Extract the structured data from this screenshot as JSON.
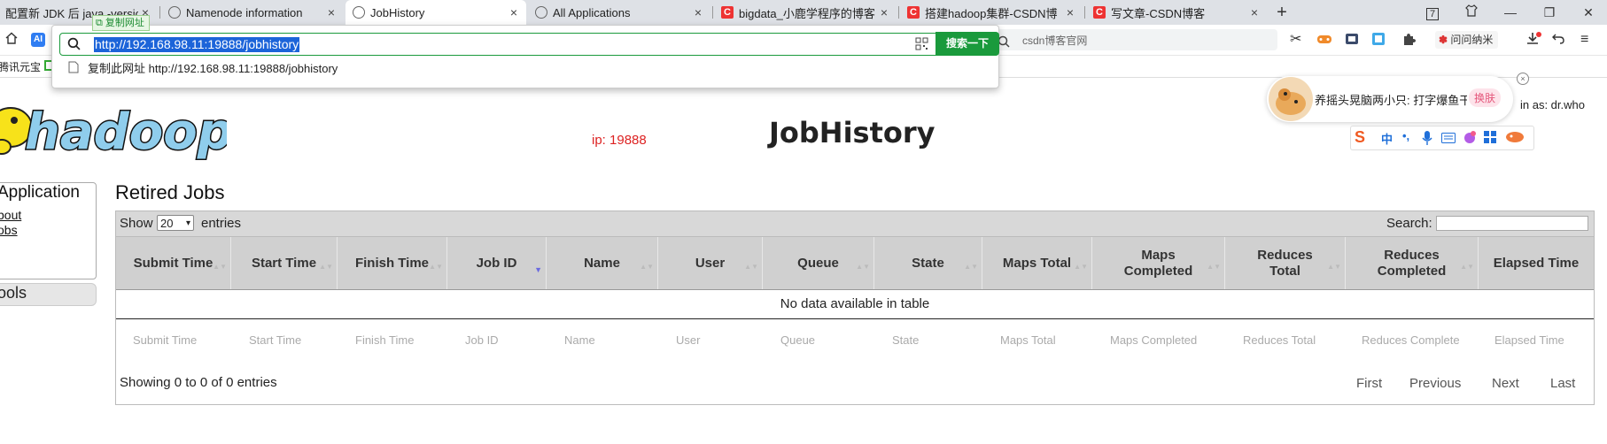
{
  "tabs": [
    {
      "label": "配置新 JDK 后 java -versio",
      "icon": "page-icon"
    },
    {
      "label": "Namenode information",
      "icon": "globe-icon"
    },
    {
      "label": "JobHistory",
      "icon": "globe-icon",
      "active": true
    },
    {
      "label": "All Applications",
      "icon": "globe-icon"
    },
    {
      "label": "bigdata_小鹿学程序的博客",
      "icon": "csdn-icon"
    },
    {
      "label": "搭建hadoop集群-CSDN博",
      "icon": "csdn-icon"
    },
    {
      "label": "写文章-CSDN博客",
      "icon": "csdn-icon"
    }
  ],
  "tab_close": "×",
  "new_tab": "+",
  "window": {
    "badge": "7",
    "minimize": "—",
    "restore": "❐",
    "close": "✕"
  },
  "toolbar": {
    "search_placeholder": "csdn博客官网",
    "ai_label": "AI",
    "wenwen_label": "问问纳米"
  },
  "omnibox": {
    "url": "http://192.168.98.11:19888/jobhistory",
    "search_button": "搜索一下",
    "copy_tip": "复制网址",
    "suggestion": "复制此网址 http://192.168.98.11:19888/jobhistory"
  },
  "bookmarks": [
    {
      "label": "腾讯元宝"
    }
  ],
  "page": {
    "logo_text": "hadoop",
    "ip_note": "ip: 19888",
    "title": "JobHistory",
    "logged_in": "in as: dr.who",
    "sidebar": {
      "heading": "Application",
      "links": [
        "bout",
        "obs"
      ],
      "tools": "ools"
    }
  },
  "sogou": {
    "message": "养摇头晃脑两小只: 打字爆鱼干",
    "skin_button": "换肤",
    "bar_items": [
      "S",
      "中",
      "•,",
      "mic",
      "kbd",
      "skin",
      "grid",
      "more"
    ]
  },
  "table": {
    "heading": "Retired Jobs",
    "show_label": "Show",
    "entries_value": "20",
    "entries_label": "entries",
    "search_label": "Search:",
    "columns": [
      "Submit Time",
      "Start Time",
      "Finish Time",
      "Job ID",
      "Name",
      "User",
      "Queue",
      "State",
      "Maps Total",
      "Maps Completed",
      "Reduces Total",
      "Reduces Completed",
      "Elapsed Time"
    ],
    "footer_columns": [
      "Submit Time",
      "Start Time",
      "Finish Time",
      "Job ID",
      "Name",
      "User",
      "Queue",
      "State",
      "Maps Total",
      "Maps Completed",
      "Reduces Total",
      "Reduces Complete",
      "Elapsed Time"
    ],
    "empty_message": "No data available in table",
    "info": "Showing 0 to 0 of 0 entries",
    "pagination": [
      "First",
      "Previous",
      "Next",
      "Last"
    ]
  },
  "colors": {
    "accent_green": "#1a9a3c",
    "selection_blue": "#1c64d9",
    "ip_red": "#dd2222",
    "header_gray": "#d0d0d0"
  }
}
